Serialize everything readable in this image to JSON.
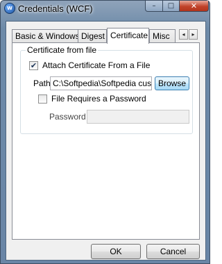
{
  "window": {
    "title": "Credentials (WCF)"
  },
  "titlebar": {
    "minimize_glyph": "–",
    "maximize_glyph": "□",
    "close_glyph": "✕"
  },
  "tabs": [
    {
      "label": "Basic & Windows"
    },
    {
      "label": "Digest"
    },
    {
      "label": "Certificate",
      "active": true
    },
    {
      "label": "Misc"
    }
  ],
  "tab_scroll": {
    "left_glyph": "◂",
    "right_glyph": "▸"
  },
  "certificate": {
    "group_title": "Certificate from file",
    "attach_label": "Attach Certificate From a File",
    "attach_checked": true,
    "path_label": "Path",
    "path_value": "C:\\Softpedia\\Softpedia custo",
    "browse_label": "Browse",
    "requires_password_label": "File Requires a Password",
    "requires_password_checked": false,
    "password_label": "Password",
    "password_value": ""
  },
  "footer": {
    "ok_label": "OK",
    "cancel_label": "Cancel"
  },
  "icons": {
    "app": "wcf-app-icon",
    "check": "✔"
  }
}
